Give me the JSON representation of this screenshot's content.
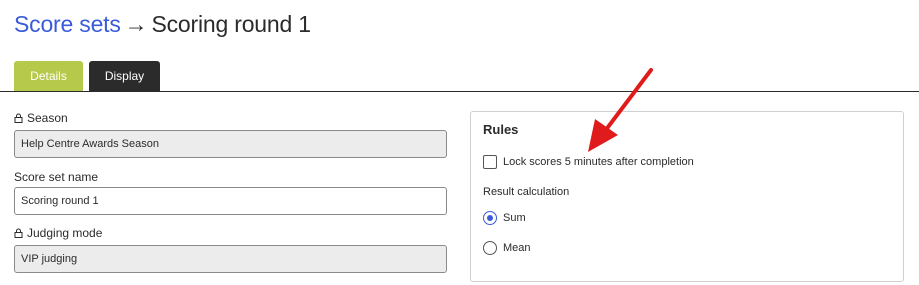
{
  "breadcrumb": {
    "parent": "Score sets",
    "separator": "→",
    "current": "Scoring round 1"
  },
  "tabs": [
    {
      "label": "Details",
      "active": true
    },
    {
      "label": "Display",
      "active": false
    }
  ],
  "form": {
    "season": {
      "label": "Season",
      "value": "Help Centre Awards Season",
      "locked": true
    },
    "name": {
      "label": "Score set name",
      "value": "Scoring round 1",
      "locked": false
    },
    "judging": {
      "label": "Judging mode",
      "value": "VIP judging",
      "locked": true
    }
  },
  "rules": {
    "title": "Rules",
    "lock_label": "Lock scores 5 minutes after completion",
    "lock_checked": false,
    "result_label": "Result calculation",
    "options": [
      {
        "label": "Sum",
        "checked": true
      },
      {
        "label": "Mean",
        "checked": false
      }
    ]
  },
  "colors": {
    "link": "#3a5bd9",
    "tab_active": "#b7c94a",
    "tab_inactive": "#2b2b2b",
    "annotation_arrow": "#e01b1b"
  },
  "icons": [
    "lock-icon",
    "annotation-arrow"
  ]
}
